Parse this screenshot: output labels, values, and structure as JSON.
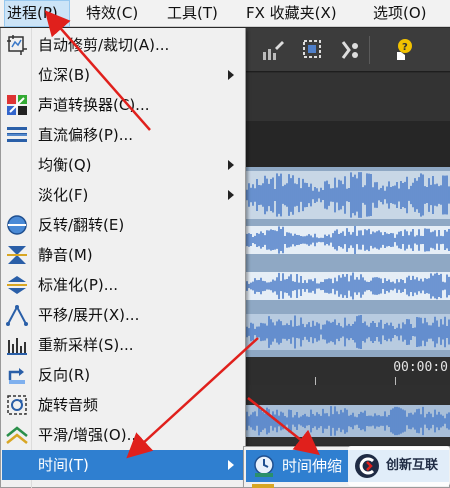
{
  "menubar": {
    "items": [
      {
        "label": "进程(P)"
      },
      {
        "label": "特效(C)"
      },
      {
        "label": "工具(T)"
      },
      {
        "label": "FX 收藏夹(X)"
      },
      {
        "label": "选项(O)"
      }
    ]
  },
  "process_menu": {
    "items": [
      {
        "label": "自动修剪/裁切(A)...",
        "icon": "auto-trim-icon",
        "submenu": false
      },
      {
        "label": "位深(B)",
        "icon": "",
        "submenu": true
      },
      {
        "label": "声道转换器(C)...",
        "icon": "channel-converter-icon",
        "submenu": false
      },
      {
        "label": "直流偏移(P)...",
        "icon": "dc-offset-icon",
        "submenu": false
      },
      {
        "label": "均衡(Q)",
        "icon": "",
        "submenu": true
      },
      {
        "label": "淡化(F)",
        "icon": "",
        "submenu": true
      },
      {
        "label": "反转/翻转(E)",
        "icon": "invert-flip-icon",
        "submenu": false
      },
      {
        "label": "静音(M)",
        "icon": "mute-icon",
        "submenu": false
      },
      {
        "label": "标准化(P)...",
        "icon": "normalize-icon",
        "submenu": false
      },
      {
        "label": "平移/展开(X)...",
        "icon": "pan-expand-icon",
        "submenu": false
      },
      {
        "label": "重新采样(S)...",
        "icon": "resample-icon",
        "submenu": false
      },
      {
        "label": "反向(R)",
        "icon": "reverse-icon",
        "submenu": false
      },
      {
        "label": "旋转音频",
        "icon": "rotate-audio-icon",
        "submenu": false
      },
      {
        "label": "平滑/增强(O)...",
        "icon": "smooth-enhance-icon",
        "submenu": false
      },
      {
        "label": "时间(T)",
        "icon": "",
        "submenu": true,
        "highlighted": true
      }
    ]
  },
  "time_submenu": {
    "highlighted_label": "时间伸缩",
    "icon": "time-stretch-icon"
  },
  "timeline": {
    "time_readout": "00:00:0"
  },
  "watermark": {
    "text": "创新互联"
  },
  "colors": {
    "highlight": "#2f7fd0",
    "arrow": "#e0201c",
    "waveform": "#4f7fc9"
  }
}
